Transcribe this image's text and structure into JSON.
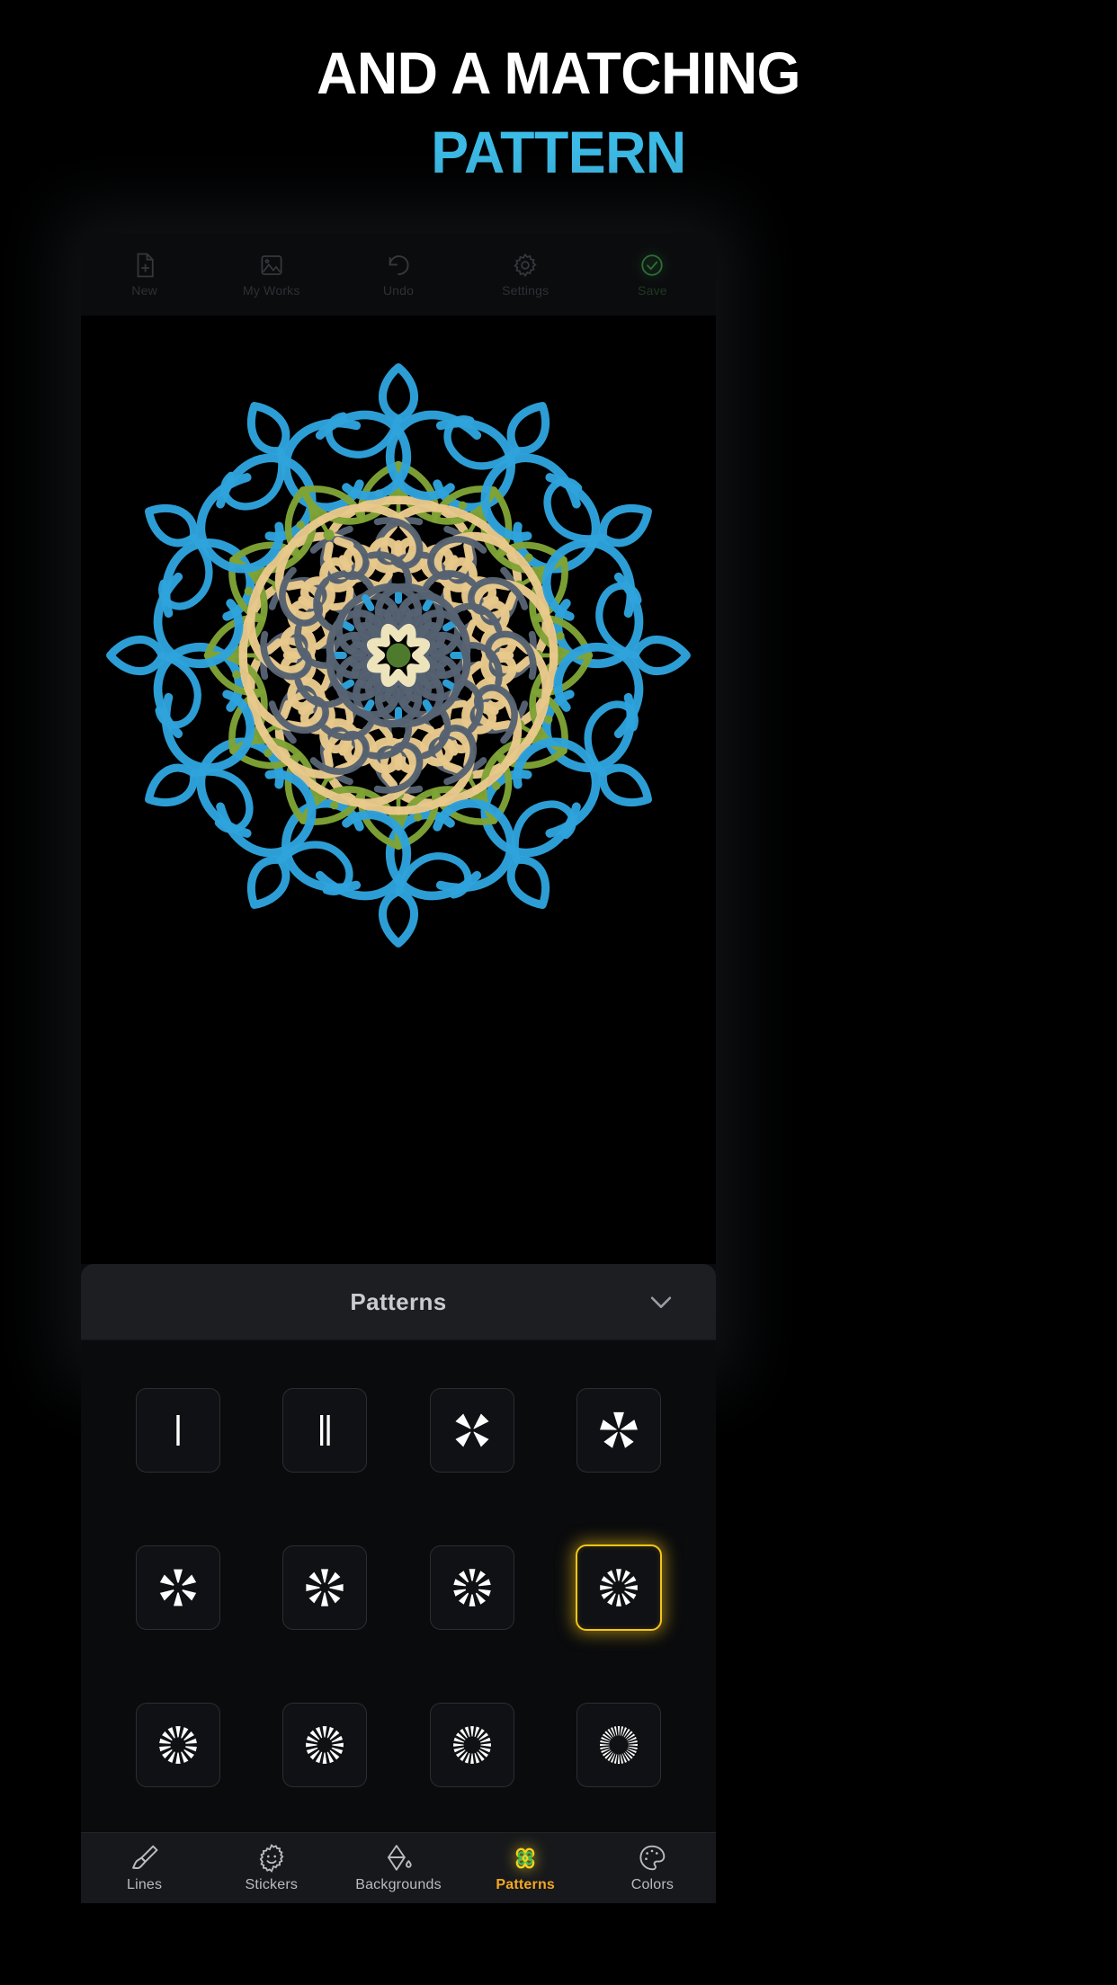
{
  "headline": {
    "line1": "AND A MATCHING",
    "line2": "PATTERN",
    "line1_color": "#FFFFFF",
    "line2_color": "#3DBCE8"
  },
  "toolbar": {
    "items": [
      {
        "label": "New",
        "icon": "new-document-icon"
      },
      {
        "label": "My Works",
        "icon": "image-gallery-icon"
      },
      {
        "label": "Undo",
        "icon": "undo-arrow-icon"
      },
      {
        "label": "Settings",
        "icon": "gear-icon"
      },
      {
        "label": "Save",
        "icon": "check-circle-icon"
      }
    ]
  },
  "artwork": {
    "description": "symmetrical mandala drawing",
    "symmetry": 12,
    "colors": {
      "blue": "#2EA3DC",
      "green": "#7FA336",
      "tan": "#E8C98C",
      "slate": "#566272",
      "cream": "#EDE4BC",
      "center_green": "#4E7A2E",
      "background": "#000000"
    }
  },
  "panel": {
    "title": "Patterns",
    "collapse_icon": "chevron-down-icon",
    "selected_index": 7,
    "tiles": [
      {
        "name": "pattern-1-line",
        "spokes": 1,
        "style": "bar"
      },
      {
        "name": "pattern-2-lines",
        "spokes": 2,
        "style": "bars"
      },
      {
        "name": "pattern-4-spoke",
        "spokes": 4,
        "style": "spokes"
      },
      {
        "name": "pattern-5-spoke",
        "spokes": 5,
        "style": "spokes"
      },
      {
        "name": "pattern-6-spoke",
        "spokes": 6,
        "style": "spokes"
      },
      {
        "name": "pattern-8-spoke",
        "spokes": 8,
        "style": "spokes"
      },
      {
        "name": "pattern-10-spoke",
        "spokes": 10,
        "style": "spokes"
      },
      {
        "name": "pattern-12-spoke",
        "spokes": 12,
        "style": "spokes"
      },
      {
        "name": "pattern-14-spoke",
        "spokes": 14,
        "style": "spokes"
      },
      {
        "name": "pattern-16-spoke",
        "spokes": 16,
        "style": "spokes"
      },
      {
        "name": "pattern-20-spoke",
        "spokes": 20,
        "style": "spokes"
      },
      {
        "name": "pattern-32-spoke",
        "spokes": 32,
        "style": "spokes"
      }
    ],
    "selected_color": "#F5C518"
  },
  "bottomnav": {
    "active": "Patterns",
    "active_color": "#F5A623",
    "items": [
      {
        "label": "Lines",
        "icon": "paintbrush-icon"
      },
      {
        "label": "Stickers",
        "icon": "smiley-sticker-icon"
      },
      {
        "label": "Backgrounds",
        "icon": "paint-bucket-icon"
      },
      {
        "label": "Patterns",
        "icon": "flower-pattern-icon"
      },
      {
        "label": "Colors",
        "icon": "palette-icon"
      }
    ]
  }
}
